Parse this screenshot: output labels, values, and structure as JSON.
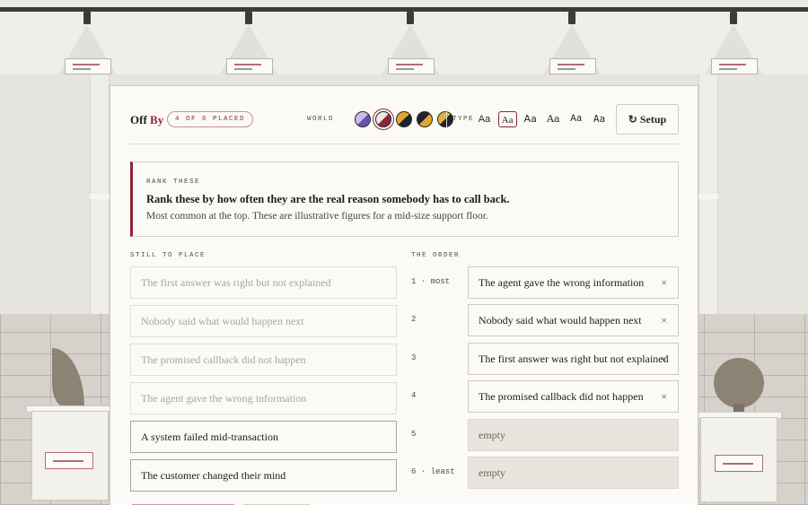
{
  "app": {
    "name_part1": "Off",
    "name_part2": "By",
    "progress_badge": "4 OF 6 PLACED"
  },
  "toolbar": {
    "world_label": "WORLD",
    "worlds": [
      {
        "icon": "world-violet-icon",
        "c1": "#6b4fb3",
        "c2": "#c9bfe6"
      },
      {
        "icon": "world-crimson-icon",
        "c1": "#8c2738",
        "c2": "#ece8e2"
      },
      {
        "icon": "world-amber-navy-icon",
        "c1": "#1d2430",
        "c2": "#e5a52f"
      },
      {
        "icon": "world-orange-navy-icon",
        "c1": "#e5a52f",
        "c2": "#1d2430"
      },
      {
        "icon": "world-gold-navy-icon",
        "c1": "#1d2430",
        "c2": "#e3b23c"
      }
    ],
    "selected_world": 1,
    "type_label": "TYPE",
    "type_options": [
      "Aa",
      "Aa",
      "Aa",
      "Aa",
      "Aa",
      "Aa"
    ],
    "selected_type": 1,
    "setup_label": "↻ Setup"
  },
  "prompt": {
    "label": "RANK THESE",
    "title": "Rank these by how often they are the real reason somebody has to call back.",
    "subtitle": "Most common at the top. These are illustrative figures for a mid-size support floor."
  },
  "pool": {
    "label": "STILL TO PLACE",
    "items": [
      {
        "text": "The first answer was right but not explained",
        "placed": true
      },
      {
        "text": "Nobody said what would happen next",
        "placed": true
      },
      {
        "text": "The promised callback did not happen",
        "placed": true
      },
      {
        "text": "The agent gave the wrong information",
        "placed": true
      },
      {
        "text": "A system failed mid-transaction",
        "placed": false
      },
      {
        "text": "The customer changed their mind",
        "placed": false
      }
    ]
  },
  "order": {
    "label": "THE ORDER",
    "slots": [
      {
        "rank": "1 · most",
        "text": "The agent gave the wrong information",
        "remove": "×"
      },
      {
        "rank": "2",
        "text": "Nobody said what would happen next",
        "remove": "×"
      },
      {
        "rank": "3",
        "text": "The first answer was right but not explained",
        "remove": "×"
      },
      {
        "rank": "4",
        "text": "The promised callback did not happen",
        "remove": "×"
      },
      {
        "rank": "5",
        "text": "empty",
        "remove": ""
      },
      {
        "rank": "6 · least",
        "text": "empty",
        "remove": ""
      }
    ]
  }
}
